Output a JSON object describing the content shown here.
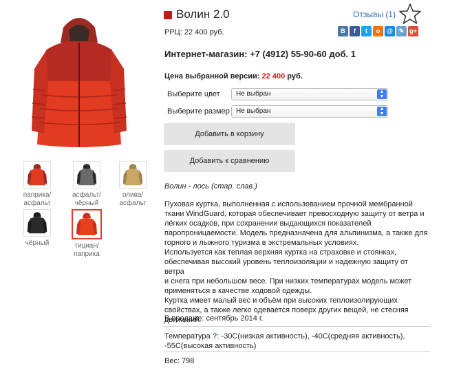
{
  "product": {
    "title": "Волин 2.0",
    "rrc": "РРЦ: 22 400 руб.",
    "reviews": "Отзывы (1)"
  },
  "socials": [
    {
      "name": "vk",
      "glyph": "B",
      "color": "#4a76a8"
    },
    {
      "name": "facebook",
      "glyph": "f",
      "color": "#3b5998"
    },
    {
      "name": "twitter",
      "glyph": "t",
      "color": "#1da1f2"
    },
    {
      "name": "odnoklassniki",
      "glyph": "o",
      "color": "#f2720c"
    },
    {
      "name": "mailru",
      "glyph": "@",
      "color": "#168de2"
    },
    {
      "name": "livejournal",
      "glyph": "✎",
      "color": "#6aa3cf"
    },
    {
      "name": "googleplus",
      "glyph": "g+",
      "color": "#dd4b39"
    }
  ],
  "shop": "Интернет-магазин: +7 (4912) 55-90-60 доб. 1",
  "price": {
    "label": "Цена выбранной версии: ",
    "value": "22 400",
    "suffix": " руб."
  },
  "options": {
    "color_label": "Выберите цвет",
    "color_value": "Не выбран",
    "size_label": "Выберите размер",
    "size_value": "Не выбран"
  },
  "buttons": {
    "cart": "Добавить в корзину",
    "compare": "Добавить к сравнению"
  },
  "thumbs": [
    {
      "label1": "паприка/",
      "label2": "асфальт",
      "body": "#e03a22",
      "top": "#9b2a22"
    },
    {
      "label1": "асфальт/",
      "label2": "чёрный",
      "body": "#6a6a6a",
      "top": "#2a2a2a"
    },
    {
      "label1": "олива/ асфальт",
      "label2": "",
      "body": "#c8a862",
      "top": "#9a8450"
    },
    {
      "label1": "чёрный",
      "label2": "",
      "body": "#2a2a2a",
      "top": "#1b1b1b"
    },
    {
      "label1": "тициан/",
      "label2": "паприка",
      "body": "#e8401f",
      "top": "#c92f1a"
    }
  ],
  "tagline": "Волин - лось (стар. слав.)",
  "description": [
    "Пуховая куртка, выполненная с использованием прочной мембранной",
    "ткани WindGuard, которая обеспечивает превосходную защиту от ветра и",
    "лёгких осадков, при сохранении выдающихся показателей",
    "паропроницаемости. Модель предназначена для альпинизма, а также для",
    "горного и лыжного туризма в экстремальных условиях.",
    "Используется как теплая верхняя куртка на страховке и стоянках,",
    "обеспечивая высокий уровень теплоизоляции и надежную защиту от ветра",
    "и снега при небольшом весе. При низких температурах модель может",
    "применяться в качестве ходовой одежды.",
    "Куртка имеет малый вес и объём при высоких теплоизолирующих",
    "свойствах, а также легко одевается поверх других вещей, не стесняя",
    "движений."
  ],
  "sale": "В продаже: сентябрь 2014 г.",
  "temperature": {
    "label": "Температура ",
    "q": "?",
    "text1": ": -30С(низкая активность), -40С(средняя активность),",
    "text2": "-55С(высокая активность)"
  },
  "weight": "Вес: 798"
}
